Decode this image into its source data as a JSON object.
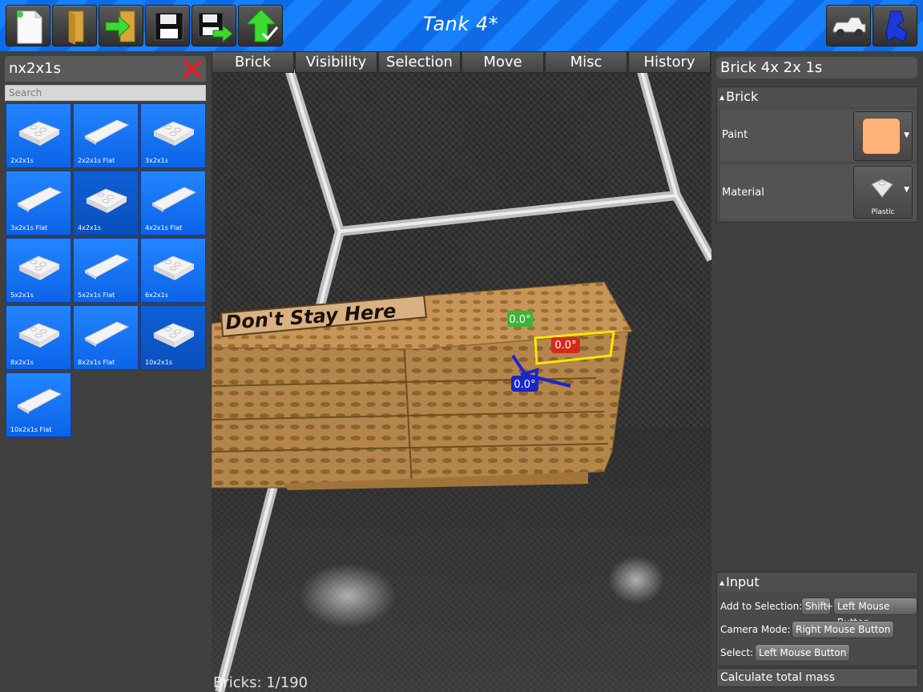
{
  "window": {
    "title": "Tank 4*"
  },
  "toolbar": {
    "buttons": [
      {
        "name": "new-file",
        "icon": "new-file-icon"
      },
      {
        "name": "open-folder",
        "icon": "folder-icon"
      },
      {
        "name": "import",
        "icon": "import-icon"
      },
      {
        "name": "save",
        "icon": "floppy-icon"
      },
      {
        "name": "save-as",
        "icon": "floppy-arrow-icon"
      },
      {
        "name": "upload",
        "icon": "upload-check-icon"
      },
      {
        "name": "vehicle-mode",
        "icon": "jeep-icon"
      },
      {
        "name": "avatar-mode",
        "icon": "avatar-icon"
      }
    ]
  },
  "brick_browser": {
    "filter": "nx2x1s",
    "search_placeholder": "Search",
    "bricks": [
      {
        "label": "2x2x1s",
        "highlight": false
      },
      {
        "label": "2x2x1s Flat",
        "highlight": false
      },
      {
        "label": "3x2x1s",
        "highlight": false
      },
      {
        "label": "3x2x1s Flat",
        "highlight": false
      },
      {
        "label": "4x2x1s",
        "highlight": true
      },
      {
        "label": "4x2x1s Flat",
        "highlight": false
      },
      {
        "label": "5x2x1s",
        "highlight": false
      },
      {
        "label": "5x2x1s Flat",
        "highlight": false
      },
      {
        "label": "6x2x1s",
        "highlight": false
      },
      {
        "label": "8x2x1s",
        "highlight": false
      },
      {
        "label": "8x2x1s Flat",
        "highlight": false
      },
      {
        "label": "10x2x1s",
        "highlight": true
      },
      {
        "label": "10x2x1s Flat",
        "highlight": false
      }
    ]
  },
  "menu": {
    "tabs": [
      "Brick",
      "Visibility",
      "Selection",
      "Move",
      "Misc",
      "History"
    ]
  },
  "viewport": {
    "sign_text": "Don't Stay Here",
    "rotation_green": "0.0°",
    "rotation_red": "0.0°",
    "rotation_blue": "0.0°",
    "brick_count": "Bricks: 1/190"
  },
  "inspector": {
    "selection_title": "Brick 4x 2x 1s",
    "brick_group": {
      "title": "Brick",
      "paint_label": "Paint",
      "paint_color": "#ffb27a",
      "material_label": "Material",
      "material_value": "Plastic"
    },
    "input_group": {
      "title": "Input",
      "add_label": "Add to Selection:",
      "shift_key": "Shift",
      "plus": "+",
      "left_mouse": "Left Mouse Button",
      "camera_label": "Camera Mode:",
      "right_mouse": "Right Mouse Button",
      "select_label": "Select:",
      "select_mouse": "Left Mouse Button"
    },
    "calc_mass": "Calculate total mass"
  },
  "colors": {
    "accent": "#1780ff",
    "selection": "#ffe600",
    "wood": "#b5864b"
  }
}
